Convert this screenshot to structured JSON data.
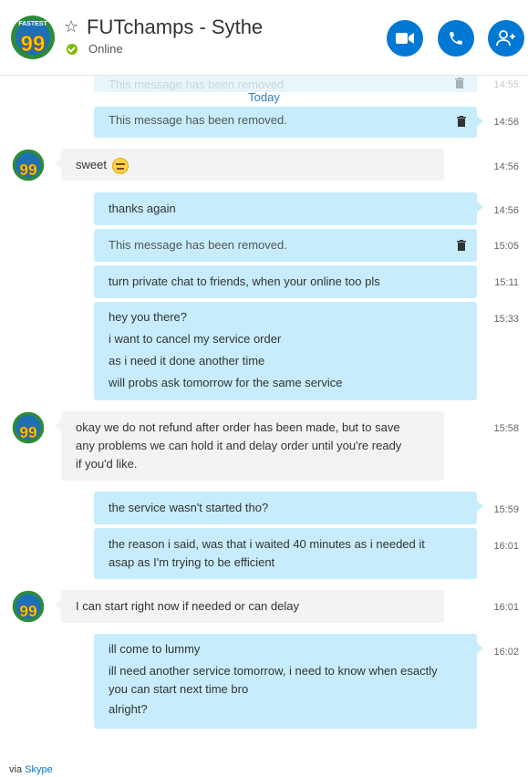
{
  "header": {
    "title": "FUTchamps - Sythe",
    "status": "Online",
    "avatar_text": "99",
    "avatar_top_text": "FASTEST"
  },
  "chat": {
    "ghost_message": "This message has been removed",
    "ghost_time": "14:55",
    "today_label": "Today",
    "messages": [
      {
        "text": "This message has been removed.",
        "time": "14:56"
      },
      {
        "text": "sweet",
        "time": "14:56"
      },
      {
        "text": "thanks again",
        "time": "14:56"
      },
      {
        "text": "This message has been removed.",
        "time": "15:05"
      },
      {
        "text": "turn private chat to friends, when your online too pls",
        "time": "15:11"
      },
      {
        "lines": [
          "hey you there?",
          "i want to cancel my service order",
          "as i need it done another time",
          "will probs ask tomorrow for the same service"
        ],
        "time": "15:33"
      },
      {
        "lines": [
          "okay we do not refund after order has been made, but to save",
          "any problems we can hold it and delay order until you're ready",
          "if you'd like."
        ],
        "time": "15:58"
      },
      {
        "text": "the service wasn't started tho?",
        "time": "15:59"
      },
      {
        "lines": [
          "the reason i said, was that i waited 40 minutes as i needed it",
          "asap as I'm trying to be efficient"
        ],
        "time": "16:01"
      },
      {
        "text": "I can start right now if needed or can delay",
        "time": "16:01"
      },
      {
        "lines": [
          "ill come to lummy",
          "ill need another service tomorrow, i need to know when esactly",
          "you can start next time bro",
          "alright?"
        ],
        "time": "16:02"
      }
    ]
  },
  "footer": {
    "via": "via",
    "link": "Skype"
  },
  "colors": {
    "accent": "#0078d4",
    "outgoing_bubble": "#c7edfc",
    "incoming_bubble": "#f1f3f5",
    "online": "#7fba00"
  },
  "icons": [
    "star-icon",
    "video-call-icon",
    "phone-call-icon",
    "add-contact-icon",
    "trash-icon",
    "smiley-icon"
  ]
}
